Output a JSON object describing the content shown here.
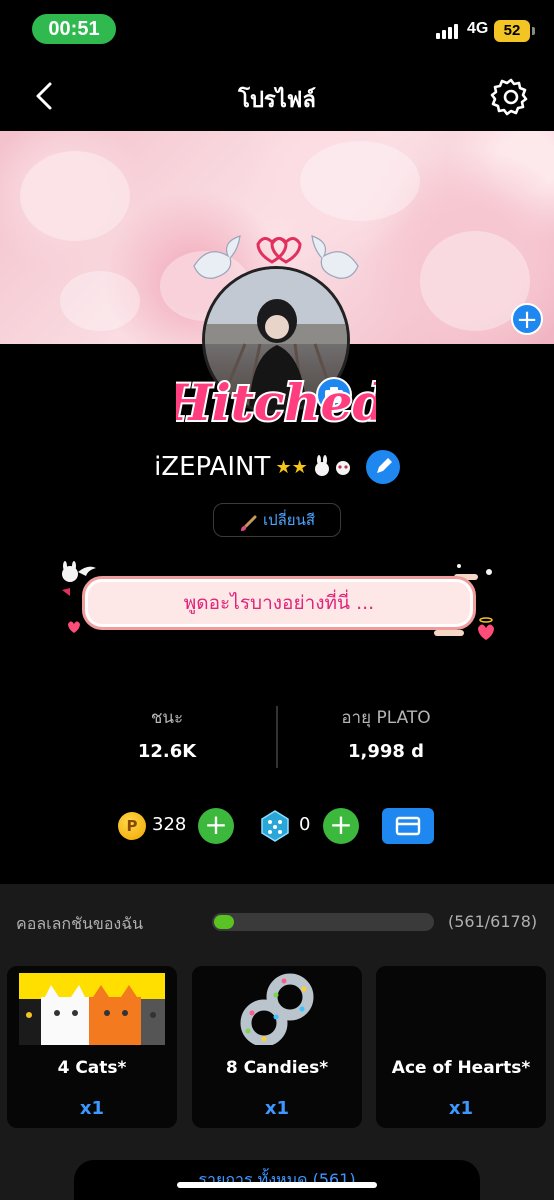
{
  "status_bar": {
    "time": "00:51",
    "network": "4G",
    "battery": "52"
  },
  "nav": {
    "title": "โปรไฟล์"
  },
  "profile": {
    "badge_text": "Hitched",
    "username": "iZEPAINT",
    "change_color_label": "เปลี่ยนสี",
    "bio_placeholder": "พูดอะไรบางอย่างที่นี่ ..."
  },
  "stats": {
    "wins_label": "ชนะ",
    "wins_value": "12.6K",
    "age_label": "อายุ PLATO",
    "age_value": "1,998 d"
  },
  "currency": {
    "coins": "328",
    "coin_symbol": "P",
    "gems": "0"
  },
  "collection": {
    "title": "คอลเลกชันของฉัน",
    "count": "(561/6178)",
    "progress_fraction": 0.091,
    "items": [
      {
        "name": "4 Cats*",
        "qty": "x1"
      },
      {
        "name": "8 Candies*",
        "qty": "x1"
      },
      {
        "name": "Ace of Hearts*",
        "qty": "x1"
      }
    ],
    "all_items_label": "รายการ ทั้งหมด (561)"
  },
  "colors": {
    "accent_blue": "#1e88f0",
    "status_green": "#2fb94e",
    "plus_green": "#3cb83c",
    "bio_pink": "#e0257a"
  }
}
